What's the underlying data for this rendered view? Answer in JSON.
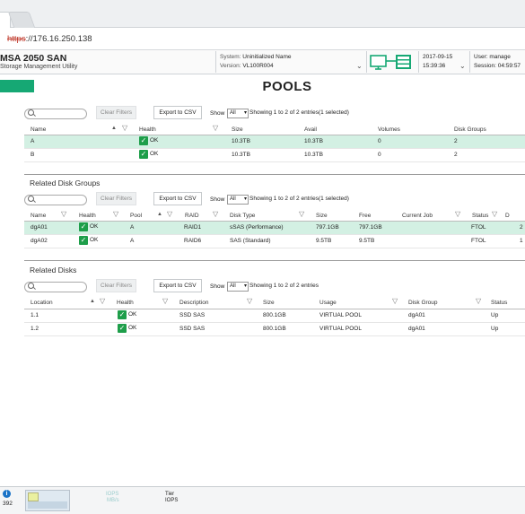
{
  "browser": {
    "url_scheme": "https",
    "url_rest": "://176.16.250.138"
  },
  "header": {
    "product": "MSA 2050 SAN",
    "subtitle": "Storage Management Utility",
    "system_label": "System:",
    "system_value": "Uninitialized Name",
    "version_label": "Version:",
    "version_value": "VL100R004",
    "date": "2017-09-15",
    "time": "15:39:36",
    "user_label": "User:",
    "user_value": "manage",
    "session_label": "Session:",
    "session_value": "04:59:57"
  },
  "page_title": "POOLS",
  "controls": {
    "clear_filters": "Clear Filters",
    "export_csv": "Export to CSV",
    "show": "Show",
    "show_value": "All"
  },
  "pools": {
    "entries": "Showing 1 to 2 of 2 entries(1 selected)",
    "columns": [
      "Name",
      "Health",
      "Size",
      "Avail",
      "Volumes",
      "Disk Groups"
    ],
    "rows": [
      {
        "name": "A",
        "health": "OK",
        "size": "10.3TB",
        "avail": "10.3TB",
        "volumes": "0",
        "disk_groups": "2"
      },
      {
        "name": "B",
        "health": "OK",
        "size": "10.3TB",
        "avail": "10.3TB",
        "volumes": "0",
        "disk_groups": "2"
      }
    ]
  },
  "disk_groups": {
    "title": "Related Disk Groups",
    "entries": "Showing 1 to 2 of 2 entries(1 selected)",
    "columns": [
      "Name",
      "Health",
      "Pool",
      "RAID",
      "Disk Type",
      "Size",
      "Free",
      "Current Job",
      "Status",
      "D"
    ],
    "rows": [
      {
        "name": "dgA01",
        "health": "OK",
        "pool": "A",
        "raid": "RAID1",
        "disk_type": "sSAS (Performance)",
        "size": "797.1GB",
        "free": "797.1GB",
        "current_job": "",
        "status": "FTOL",
        "d": "2"
      },
      {
        "name": "dgA02",
        "health": "OK",
        "pool": "A",
        "raid": "RAID6",
        "disk_type": "SAS (Standard)",
        "size": "9.5TB",
        "free": "9.5TB",
        "current_job": "",
        "status": "FTOL",
        "d": "1"
      }
    ]
  },
  "disks": {
    "title": "Related Disks",
    "entries": "Showing 1 to 2 of 2 entries",
    "columns": [
      "Location",
      "Health",
      "Description",
      "Size",
      "Usage",
      "Disk Group",
      "Status"
    ],
    "rows": [
      {
        "location": "1.1",
        "health": "OK",
        "description": "SSD SAS",
        "size": "800.1GB",
        "usage": "VIRTUAL POOL",
        "disk_group": "dgA01",
        "status": "Up"
      },
      {
        "location": "1.2",
        "health": "OK",
        "description": "SSD SAS",
        "size": "800.1GB",
        "usage": "VIRTUAL POOL",
        "disk_group": "dgA01",
        "status": "Up"
      }
    ]
  },
  "footer": {
    "info_count": "392",
    "iops_label": "IOPS",
    "mbs_label": "MB/s",
    "tier_label": "Tier",
    "tier_iops_label": "IOPS"
  },
  "colors": {
    "accent_green": "#16a874",
    "selected_row": "#d3f0e3",
    "health_ok": "#1e9e4a"
  }
}
